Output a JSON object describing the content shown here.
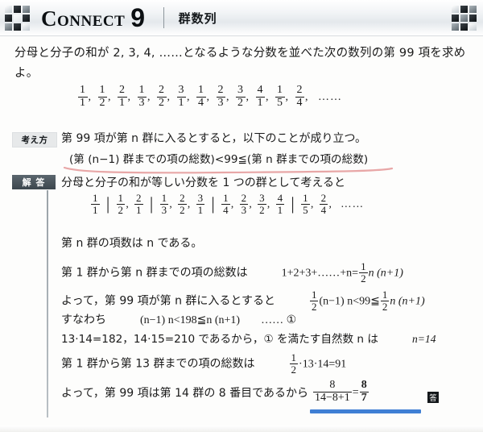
{
  "header": {
    "series_title": "Connect",
    "number": "9",
    "subject": "群数列",
    "left_icon": "grid-3x3-icon",
    "right_icon": "grid-3x3-icon"
  },
  "problem": {
    "text": "分母と分子の和が 2, 3, 4, ……となるような分数を並べた次の数列の第 99 項を求めよ。",
    "sequence": [
      {
        "n": "1",
        "d": "1"
      },
      {
        "n": "1",
        "d": "2"
      },
      {
        "n": "2",
        "d": "1"
      },
      {
        "n": "1",
        "d": "3"
      },
      {
        "n": "2",
        "d": "2"
      },
      {
        "n": "3",
        "d": "1"
      },
      {
        "n": "1",
        "d": "4"
      },
      {
        "n": "2",
        "d": "3"
      },
      {
        "n": "3",
        "d": "2"
      },
      {
        "n": "4",
        "d": "1"
      },
      {
        "n": "1",
        "d": "5"
      },
      {
        "n": "2",
        "d": "4"
      }
    ],
    "sequence_tail": "……"
  },
  "approach": {
    "label": "考え方",
    "line1": "第 99 項が第 n 群に入るとすると，以下のことが成り立つ。",
    "line2": "(第 (n−1) 群までの項の総数)<99≦(第 n 群までの項の総数)",
    "underline_color": "#e8a7a7"
  },
  "solution": {
    "label": "解 答",
    "intro": "分母と分子の和が等しい分数を 1 つの群として考えると",
    "groups": [
      [
        {
          "n": "1",
          "d": "1"
        }
      ],
      [
        {
          "n": "1",
          "d": "2"
        },
        {
          "n": "2",
          "d": "1"
        }
      ],
      [
        {
          "n": "1",
          "d": "3"
        },
        {
          "n": "2",
          "d": "2"
        },
        {
          "n": "3",
          "d": "1"
        }
      ],
      [
        {
          "n": "1",
          "d": "4"
        },
        {
          "n": "2",
          "d": "3"
        },
        {
          "n": "3",
          "d": "2"
        },
        {
          "n": "4",
          "d": "1"
        }
      ],
      [
        {
          "n": "1",
          "d": "5"
        },
        {
          "n": "2",
          "d": "4"
        }
      ]
    ],
    "groups_tail": "……",
    "line_terms": "第 n 群の項数は n である。",
    "line_total_label": "第 1 群から第 n 群までの項の総数は",
    "line_total_math_prefix": "1+2+3+……+n=",
    "line_total_math_suffix": "n (n+1)",
    "line_yotte_label": "よって，第 99 項が第 n 群に入るとすると",
    "line_yotte_math_mid": "(n−1) n<99≦",
    "line_yotte_math_suffix": "n (n+1)",
    "line_sunawachi_label": "すなわち",
    "line_sunawachi_math": "(n−1) n<198≦n (n+1)",
    "line_sunawachi_ref": "…… ①",
    "line_product_text": "13·14=182，14·15=210 であるから，① を満たす自然数 n は",
    "line_product_result": "n=14",
    "line_g13_label": "第 1 群から第 13 群までの項の総数は",
    "line_g13_math": "·13·14=91",
    "line_conclusion": "よって，第 99 項は第 14 群の 8 番目であるから",
    "answer": {
      "left_numerator": "8",
      "left_denominator": "14−8+1",
      "equals": "=",
      "right_numerator": "8",
      "right_denominator": "7",
      "badge": "答",
      "underline_color": "#3f7fd4"
    },
    "half_numerator": "1",
    "half_denominator": "2"
  }
}
